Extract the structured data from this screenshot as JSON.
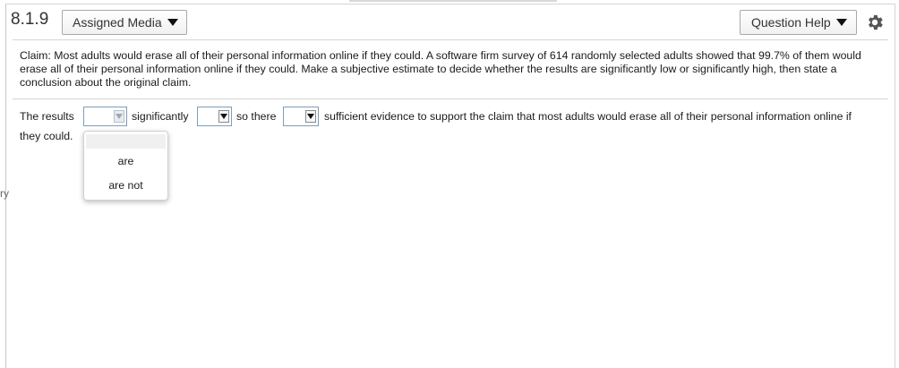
{
  "header": {
    "question_number": "8.1.9",
    "assigned_media_label": "Assigned Media",
    "question_help_label": "Question Help"
  },
  "question": {
    "claim_text": "Claim: Most adults would erase all of their personal information online if they could. A software firm survey of 614 randomly selected adults showed that 99.7% of them would erase all of their personal information online if they could. Make a subjective estimate to decide whether the results are significantly low or significantly high, then state a conclusion about the original claim."
  },
  "answer": {
    "part1": "The results",
    "part2": "significantly",
    "part3": "so there",
    "part4": "sufficient evidence to support the claim that most adults would erase all of their personal information online if",
    "part5": "they could."
  },
  "dropdown": {
    "options": [
      "are",
      "are not"
    ]
  },
  "side_marks": [
    "ry"
  ]
}
